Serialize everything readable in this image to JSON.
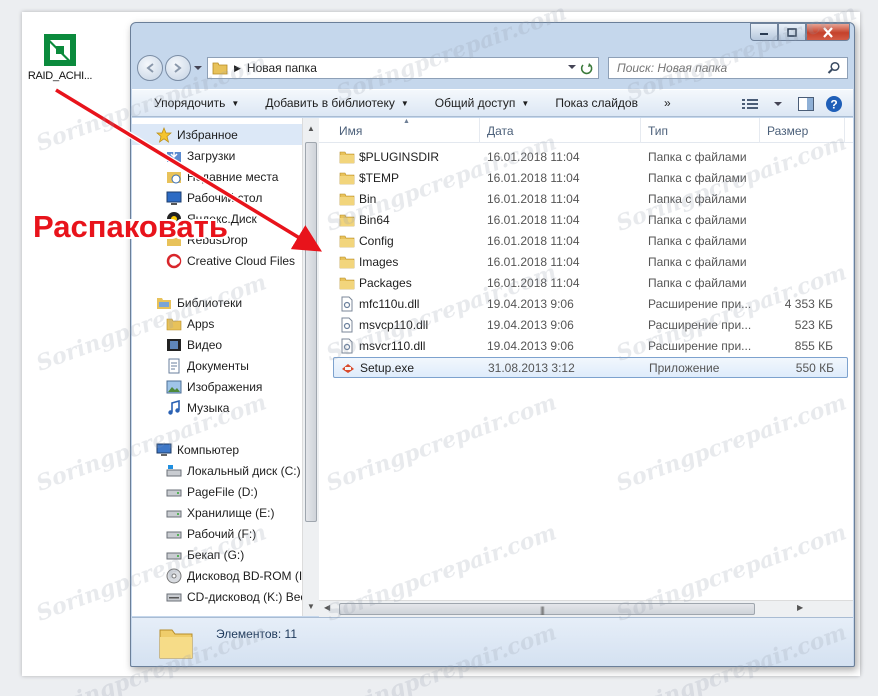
{
  "desktop": {
    "icon_label": "RAID_ACHI..."
  },
  "window": {
    "address": {
      "crumb": "Новая папка"
    },
    "search": {
      "placeholder": "Поиск: Новая папка"
    }
  },
  "toolbar": {
    "items": [
      {
        "label": "Упорядочить",
        "has_caret": true
      },
      {
        "label": "Добавить в библиотеку",
        "has_caret": true
      },
      {
        "label": "Общий доступ",
        "has_caret": true
      },
      {
        "label": "Показ слайдов",
        "has_caret": false
      }
    ],
    "more": "»"
  },
  "nav": {
    "favorites_label": "Избранное",
    "favorites": [
      "Загрузки",
      "Недавние места",
      "Рабочий стол",
      "Яндекс.Диск",
      "RebusDrop",
      "Creative Cloud Files"
    ],
    "libraries_label": "Библиотеки",
    "libraries": [
      "Apps",
      "Видео",
      "Документы",
      "Изображения",
      "Музыка"
    ],
    "computer_label": "Компьютер",
    "drives": [
      "Локальный диск (C:)",
      "PageFile (D:)",
      "Хранилище (E:)",
      "Рабочий (F:)",
      "Бекап (G:)",
      "Дисковод BD-ROM (I",
      "CD-дисковод (K:) Bee"
    ]
  },
  "columns": {
    "name": "Имя",
    "date": "Дата",
    "type": "Тип",
    "size": "Размер"
  },
  "files": [
    {
      "name": "$PLUGINSDIR",
      "date": "16.01.2018 11:04",
      "type": "Папка с файлами",
      "size": "",
      "kind": "folder"
    },
    {
      "name": "$TEMP",
      "date": "16.01.2018 11:04",
      "type": "Папка с файлами",
      "size": "",
      "kind": "folder"
    },
    {
      "name": "Bin",
      "date": "16.01.2018 11:04",
      "type": "Папка с файлами",
      "size": "",
      "kind": "folder"
    },
    {
      "name": "Bin64",
      "date": "16.01.2018 11:04",
      "type": "Папка с файлами",
      "size": "",
      "kind": "folder"
    },
    {
      "name": "Config",
      "date": "16.01.2018 11:04",
      "type": "Папка с файлами",
      "size": "",
      "kind": "folder"
    },
    {
      "name": "Images",
      "date": "16.01.2018 11:04",
      "type": "Папка с файлами",
      "size": "",
      "kind": "folder"
    },
    {
      "name": "Packages",
      "date": "16.01.2018 11:04",
      "type": "Папка с файлами",
      "size": "",
      "kind": "folder"
    },
    {
      "name": "mfc110u.dll",
      "date": "19.04.2013 9:06",
      "type": "Расширение при...",
      "size": "4 353 КБ",
      "kind": "dll"
    },
    {
      "name": "msvcp110.dll",
      "date": "19.04.2013 9:06",
      "type": "Расширение при...",
      "size": "523 КБ",
      "kind": "dll"
    },
    {
      "name": "msvcr110.dll",
      "date": "19.04.2013 9:06",
      "type": "Расширение при...",
      "size": "855 КБ",
      "kind": "dll"
    },
    {
      "name": "Setup.exe",
      "date": "31.08.2013 3:12",
      "type": "Приложение",
      "size": "550 КБ",
      "kind": "exe",
      "selected": true
    }
  ],
  "status": {
    "count": "Элементов: 11"
  },
  "annotation": {
    "callout": "Распаковать",
    "color": "#e8131b"
  },
  "watermark": "Soringpcrepair.com"
}
